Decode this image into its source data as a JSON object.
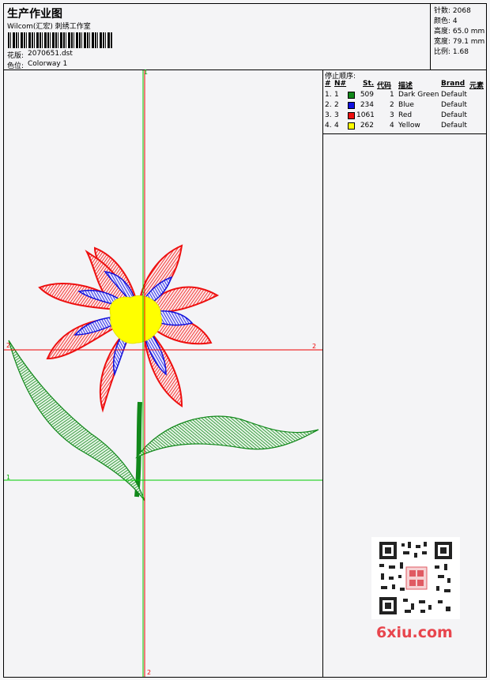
{
  "header": {
    "title": "生产作业图",
    "subtitle": "Wilcom(汇宏) 刺绣工作室",
    "design_label": "花版:",
    "design_value": "2070651.dst",
    "colorway_label": "色位:",
    "colorway_value": "Colorway 1"
  },
  "stats": {
    "stitches": "针数: 2068",
    "colors": "颜色: 4",
    "height": "高度: 65.0 mm",
    "width": "宽度: 79.1 mm",
    "scale": "比例: 1.68"
  },
  "stop_sequence": {
    "title": "停止顺序:",
    "headers": [
      "#",
      "N#",
      "St.",
      "代码",
      "描述",
      "Brand",
      "元素"
    ],
    "rows": [
      {
        "idx": "1.",
        "n": "1",
        "st": "509",
        "code": "1",
        "desc": "Dark Green",
        "brand": "Default",
        "color": "#11881a"
      },
      {
        "idx": "2.",
        "n": "2",
        "st": "234",
        "code": "2",
        "desc": "Blue",
        "brand": "Default",
        "color": "#1010dd"
      },
      {
        "idx": "3.",
        "n": "3",
        "st": "1061",
        "code": "3",
        "desc": "Red",
        "brand": "Default",
        "color": "#ee1010"
      },
      {
        "idx": "4.",
        "n": "4",
        "st": "262",
        "code": "4",
        "desc": "Yellow",
        "brand": "Default",
        "color": "#ffff00"
      }
    ]
  },
  "axes": {
    "v_top": "1",
    "v_bottom": "2",
    "h_left_red": "2",
    "h_right_red": "2",
    "h_left_green": "1"
  },
  "watermark": {
    "site": "6xiu.com"
  },
  "colors": {
    "guide_green": "#00cc00",
    "guide_red": "#ee0000",
    "petal_red": "#ee1010",
    "petal_blue": "#1010dd",
    "center_yellow": "#ffff00",
    "leaf_green": "#11881a"
  }
}
